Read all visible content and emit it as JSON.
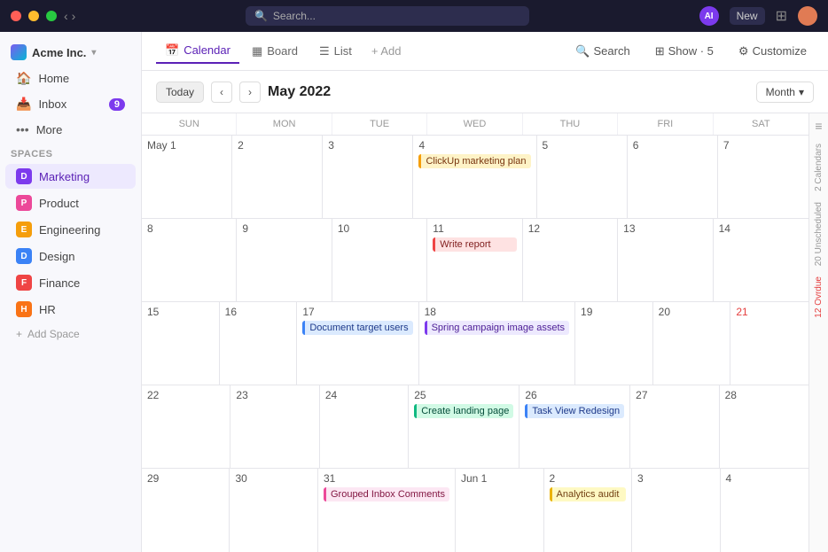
{
  "topbar": {
    "search_placeholder": "Search...",
    "ai_label": "AI",
    "new_label": "New"
  },
  "sidebar": {
    "workspace": "Acme Inc.",
    "nav_items": [
      {
        "label": "Home",
        "icon": "🏠"
      },
      {
        "label": "Inbox",
        "icon": "📥",
        "badge": "9"
      },
      {
        "label": "More",
        "icon": "•••"
      }
    ],
    "spaces_title": "Spaces",
    "spaces": [
      {
        "label": "Marketing",
        "icon": "D",
        "color": "#7c3aed",
        "active": true
      },
      {
        "label": "Product",
        "icon": "P",
        "color": "#ec4899"
      },
      {
        "label": "Engineering",
        "icon": "E",
        "color": "#f59e0b"
      },
      {
        "label": "Design",
        "icon": "D",
        "color": "#3b82f6"
      },
      {
        "label": "Finance",
        "icon": "F",
        "color": "#ef4444"
      },
      {
        "label": "HR",
        "icon": "H",
        "color": "#f97316"
      }
    ],
    "add_space_label": "Add Space"
  },
  "views": {
    "tabs": [
      {
        "label": "Calendar",
        "icon": "📅",
        "active": true
      },
      {
        "label": "Board",
        "icon": "▦"
      },
      {
        "label": "List",
        "icon": "☰"
      }
    ],
    "add_label": "+ Add"
  },
  "toolbar": {
    "search_label": "Search",
    "show_label": "Show · 5",
    "customize_label": "Customize"
  },
  "calendar": {
    "today_label": "Today",
    "title": "May 2022",
    "month_label": "Month",
    "day_names": [
      "Sun",
      "Mon",
      "Tue",
      "Wed",
      "Thu",
      "Fri",
      "Sat"
    ],
    "weeks": [
      [
        {
          "num": "May 1",
          "other": false
        },
        {
          "num": "2",
          "other": false
        },
        {
          "num": "3",
          "other": false
        },
        {
          "num": "4",
          "other": false,
          "events": [
            {
              "label": "ClickUp marketing plan",
              "style": "event-orange"
            }
          ]
        },
        {
          "num": "5",
          "other": false
        },
        {
          "num": "6",
          "other": false
        },
        {
          "num": "7",
          "other": false
        }
      ],
      [
        {
          "num": "8",
          "other": false
        },
        {
          "num": "9",
          "other": false
        },
        {
          "num": "10",
          "other": false
        },
        {
          "num": "11",
          "other": false,
          "events": [
            {
              "label": "Write report",
              "style": "event-red"
            }
          ]
        },
        {
          "num": "12",
          "other": false
        },
        {
          "num": "13",
          "other": false
        },
        {
          "num": "14",
          "other": false
        }
      ],
      [
        {
          "num": "15",
          "other": false
        },
        {
          "num": "16",
          "other": false
        },
        {
          "num": "17",
          "other": false,
          "events": [
            {
              "label": "Document target users",
              "style": "event-blue"
            }
          ]
        },
        {
          "num": "18",
          "other": false,
          "events": [
            {
              "label": "Spring campaign image assets",
              "style": "event-purple"
            }
          ]
        },
        {
          "num": "19",
          "other": false
        },
        {
          "num": "20",
          "other": false
        },
        {
          "num": "21",
          "other": false,
          "red": true
        }
      ],
      [
        {
          "num": "22",
          "other": false
        },
        {
          "num": "23",
          "other": false
        },
        {
          "num": "24",
          "other": false
        },
        {
          "num": "25",
          "other": false,
          "events": [
            {
              "label": "Create landing page",
              "style": "event-green"
            }
          ]
        },
        {
          "num": "26",
          "other": false,
          "events": [
            {
              "label": "Task View Redesign",
              "style": "event-blue"
            }
          ]
        },
        {
          "num": "27",
          "other": false
        },
        {
          "num": "28",
          "other": false
        }
      ],
      [
        {
          "num": "29",
          "other": false
        },
        {
          "num": "30",
          "other": false
        },
        {
          "num": "31",
          "other": false,
          "events": [
            {
              "label": "Grouped Inbox Comments",
              "style": "event-pink"
            }
          ]
        },
        {
          "num": "Jun 1",
          "other": false
        },
        {
          "num": "2",
          "other": false,
          "events": [
            {
              "label": "Analytics audit",
              "style": "event-yellow"
            }
          ]
        },
        {
          "num": "3",
          "other": false
        },
        {
          "num": "4",
          "other": false
        }
      ]
    ]
  },
  "right_sidebar": {
    "toggle_icon": "≡",
    "calendars_label": "2 Calendars",
    "unscheduled_label": "20 Unscheduled",
    "overdue_label": "12 Ovrdue"
  }
}
